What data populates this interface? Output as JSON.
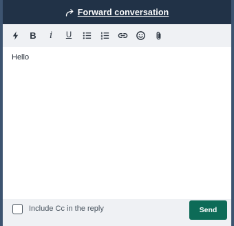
{
  "header": {
    "title": "Forward conversation",
    "icon": "forward-arrow-icon",
    "background": "#213247"
  },
  "toolbar": {
    "items": [
      {
        "name": "quick-actions-button",
        "icon": "lightning-icon"
      },
      {
        "name": "bold-button",
        "icon": "bold-icon",
        "glyph": "B"
      },
      {
        "name": "italic-button",
        "icon": "italic-icon",
        "glyph": "i"
      },
      {
        "name": "underline-button",
        "icon": "underline-icon",
        "glyph": "U"
      },
      {
        "name": "bullet-list-button",
        "icon": "bullet-list-icon"
      },
      {
        "name": "numbered-list-button",
        "icon": "numbered-list-icon"
      },
      {
        "name": "link-button",
        "icon": "link-icon"
      },
      {
        "name": "emoji-button",
        "icon": "smiley-icon"
      },
      {
        "name": "attachment-button",
        "icon": "paperclip-icon"
      }
    ]
  },
  "editor": {
    "text": "Hello"
  },
  "footer": {
    "cc_label": "Include Cc in the reply",
    "cc_checked": false,
    "send_label": "Send",
    "send_color": "#0d6b57"
  }
}
